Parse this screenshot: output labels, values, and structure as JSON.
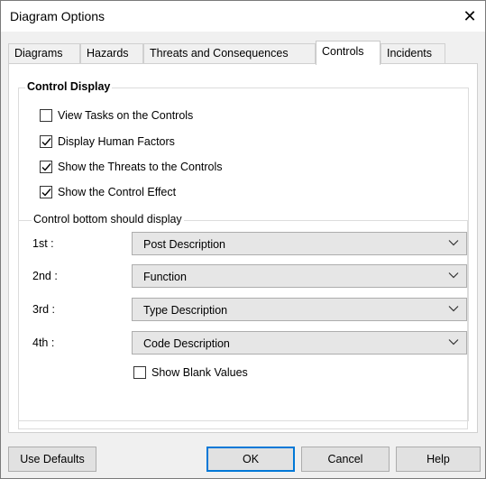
{
  "window": {
    "title": "Diagram Options",
    "close_glyph": "✕"
  },
  "tabs": [
    {
      "label": "Diagrams"
    },
    {
      "label": "Hazards"
    },
    {
      "label": "Threats and Consequences"
    },
    {
      "label": "Controls"
    },
    {
      "label": "Incidents"
    }
  ],
  "active_tab": "Controls",
  "control_display": {
    "label": "Control Display",
    "checkboxes": [
      {
        "label": "View Tasks on the Controls",
        "checked": false
      },
      {
        "label": "Display Human Factors",
        "checked": true
      },
      {
        "label": "Show the Threats to the Controls",
        "checked": true
      },
      {
        "label": "Show the Control Effect",
        "checked": true
      }
    ]
  },
  "bottom_display": {
    "label": "Control bottom should display",
    "rows": [
      {
        "label": "1st :",
        "value": "Post Description"
      },
      {
        "label": "2nd :",
        "value": "Function"
      },
      {
        "label": "3rd :",
        "value": "Type Description"
      },
      {
        "label": "4th :",
        "value": "Code Description"
      }
    ],
    "blank_values": {
      "label": "Show Blank Values",
      "checked": false
    }
  },
  "footer": {
    "use_defaults": "Use Defaults",
    "ok": "OK",
    "cancel": "Cancel",
    "help": "Help"
  },
  "colors": {
    "dialog_bg": "#f0f0f0",
    "panel_bg": "#ffffff",
    "select_bg": "#e6e6e6",
    "focus_border": "#0078d7"
  }
}
